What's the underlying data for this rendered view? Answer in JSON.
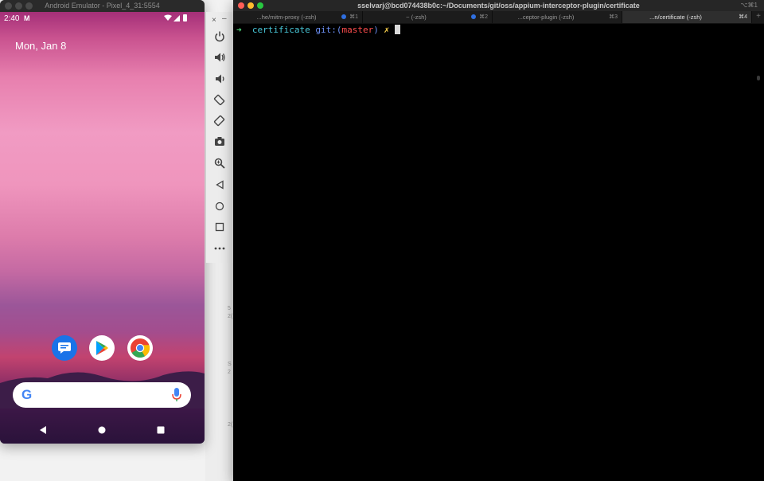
{
  "emulator": {
    "window_title": "Android Emulator - Pixel_4_31:5554",
    "status_bar": {
      "time": "2:40",
      "gmail_badge": "M",
      "icons": "▾◢▮"
    },
    "date": "Mon, Jan 8",
    "dock_apps": [
      {
        "name": "Messages",
        "icon": "messages-icon"
      },
      {
        "name": "Play Store",
        "icon": "play-store-icon"
      },
      {
        "name": "Chrome",
        "icon": "chrome-icon"
      }
    ],
    "search": {
      "logo": "G",
      "mic_icon": "mic-icon"
    },
    "nav": [
      "back-icon",
      "home-icon",
      "recents-icon"
    ],
    "toolbar": {
      "close": "×",
      "minimize": "–",
      "buttons": [
        "power-icon",
        "volume-up-icon",
        "volume-down-icon",
        "rotate-left-icon",
        "rotate-right-icon",
        "camera-icon",
        "zoom-icon",
        "back-icon",
        "home-icon",
        "overview-icon",
        "more-icon"
      ]
    }
  },
  "desktop": {
    "fragments": [
      "5",
      "2(",
      "S",
      "2",
      "2("
    ]
  },
  "terminal": {
    "window_title": "sselvarj@bcd074438b0c:~/Documents/git/oss/appium-interceptor-plugin/certificate",
    "window_shortcut": "⌥⌘1",
    "tabs": [
      {
        "label": "...he/mitm-proxy (-zsh)",
        "shortcut": "⌘1",
        "dot": true,
        "active": false
      },
      {
        "label": "~ (-zsh)",
        "shortcut": "⌘2",
        "dot": true,
        "active": false
      },
      {
        "label": "...ceptor-plugin (-zsh)",
        "shortcut": "⌘3",
        "dot": false,
        "active": false
      },
      {
        "label": "...n/certificate (-zsh)",
        "shortcut": "⌘4",
        "dot": false,
        "active": true
      }
    ],
    "add_tab": "+",
    "prompt": {
      "arrow": "➜",
      "dir": "certificate",
      "git_prefix": "git:(",
      "branch": "master",
      "git_suffix": ")",
      "dirty": "✗"
    }
  },
  "colors": {
    "terminal_bg": "#000000",
    "prompt_arrow": "#4fd47a",
    "prompt_dir": "#48c7d8",
    "prompt_git": "#6b8ef2",
    "prompt_branch": "#ff4d4d",
    "prompt_dirty": "#ffd54d",
    "tab_dot": "#2f6fe0"
  }
}
